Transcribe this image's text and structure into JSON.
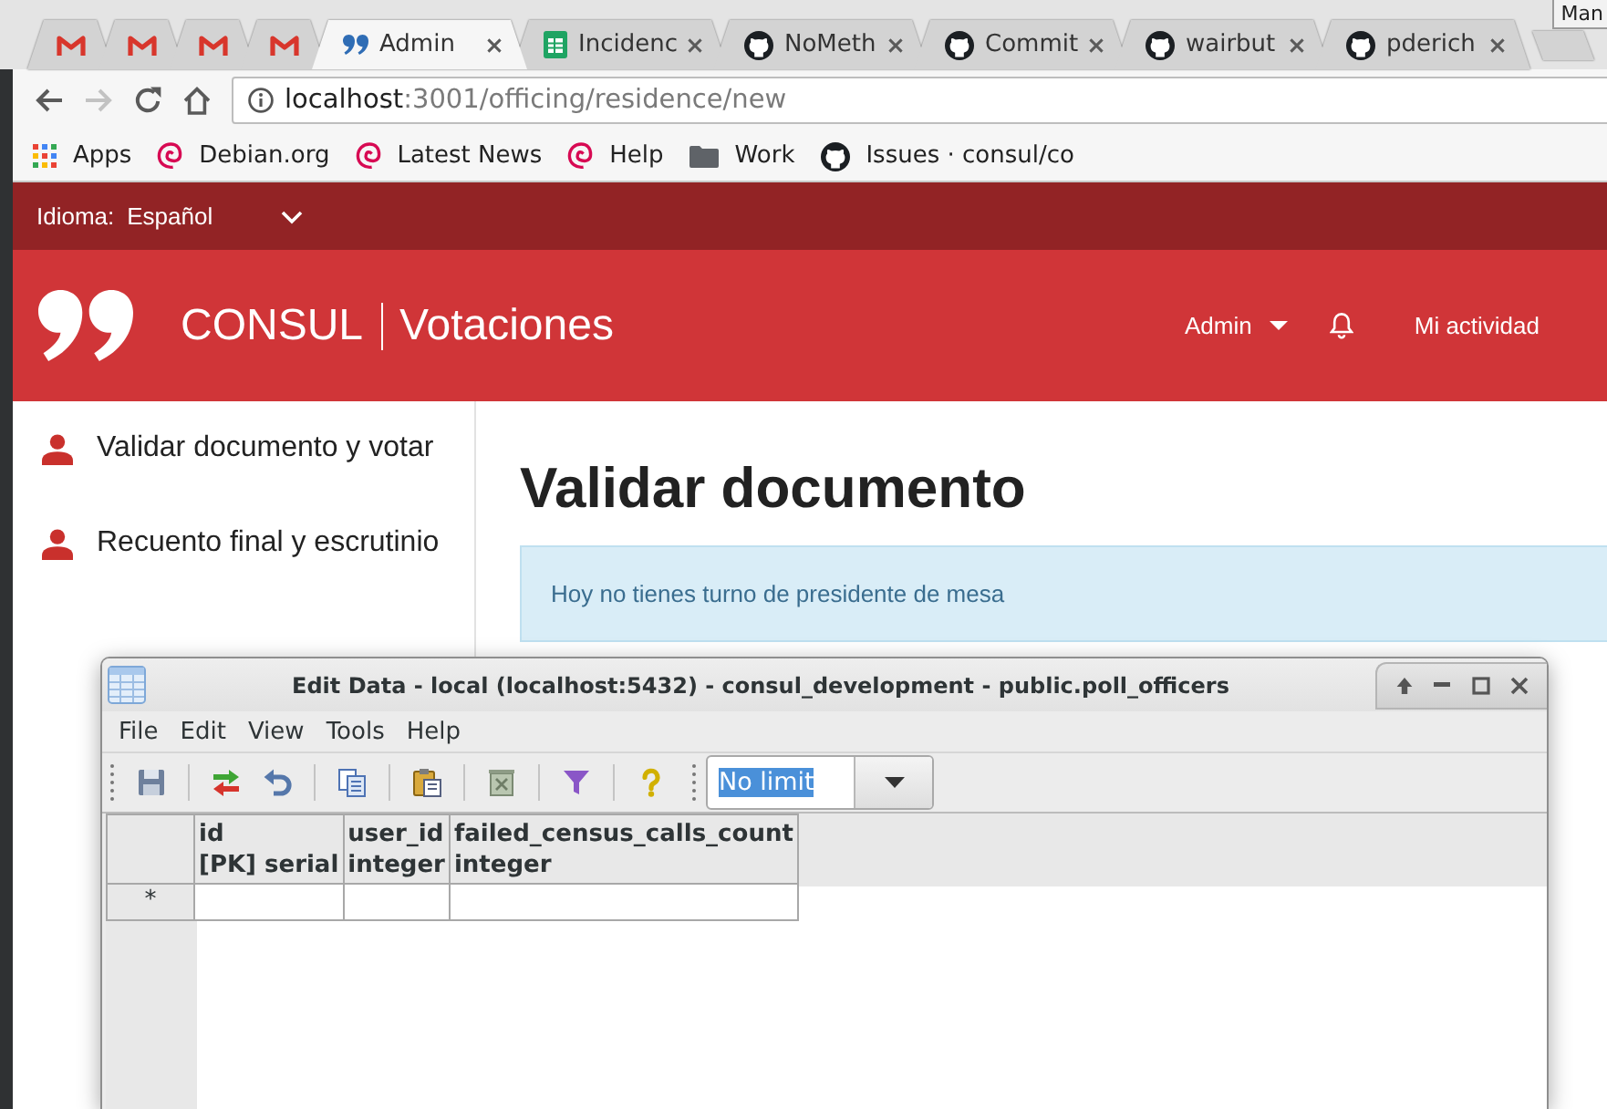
{
  "browser": {
    "tabs": [
      {
        "kind": "mail",
        "selected": false
      },
      {
        "kind": "mail",
        "selected": false
      },
      {
        "kind": "mail",
        "selected": false
      },
      {
        "kind": "mail",
        "selected": false
      },
      {
        "kind": "quotes",
        "title": "Admin",
        "selected": true
      },
      {
        "kind": "sheet",
        "title": "Incidenc",
        "selected": false
      },
      {
        "kind": "octocat",
        "title": "NoMeth",
        "selected": false
      },
      {
        "kind": "octocat",
        "title": "Commit",
        "selected": false
      },
      {
        "kind": "octocat",
        "title": "wairbut",
        "selected": false
      },
      {
        "kind": "octocat",
        "title": "pderich",
        "selected": false
      }
    ],
    "profile": "Man",
    "navigation": [
      {
        "kind": "back",
        "disabled": false
      },
      {
        "kind": "forward",
        "disabled": true
      },
      {
        "kind": "reload",
        "disabled": false
      },
      {
        "kind": "home",
        "disabled": false
      }
    ],
    "address": {
      "host": "localhost",
      "path": ":3001/officing/residence/new"
    },
    "bookmarks": [
      {
        "kind": "apps",
        "label": "Apps"
      },
      {
        "kind": "swirl",
        "label": "Debian.org"
      },
      {
        "kind": "swirl",
        "label": "Latest News"
      },
      {
        "kind": "swirl",
        "label": "Help"
      },
      {
        "kind": "folder",
        "label": "Work"
      },
      {
        "kind": "octocat",
        "label": "Issues · consul/co"
      }
    ]
  },
  "page": {
    "language": {
      "label": "Idioma:",
      "value": "Español"
    },
    "header": {
      "brand": "CONSUL",
      "section": "Votaciones",
      "user_menu": "Admin",
      "activity_link": "Mi actividad"
    },
    "sidebar": {
      "items": [
        {
          "label": "Validar documento y votar",
          "selected": false
        },
        {
          "label": "Recuento final y escrutinio",
          "selected": false
        }
      ]
    },
    "title": "Validar documento",
    "notice": "Hoy no tienes turno de presidente de mesa"
  },
  "dialog": {
    "title": "Edit Data - local (localhost:5432) - consul_development - public.poll_officers",
    "menu": [
      "File",
      "Edit",
      "View",
      "Tools",
      "Help"
    ],
    "row_limit": {
      "value": "No limit",
      "highlighted": true
    },
    "grid": {
      "columns": [
        {
          "name": "id",
          "type": "[PK] serial"
        },
        {
          "name": "user_id",
          "type": "integer"
        },
        {
          "name": "failed_census_calls_count",
          "type": "integer"
        }
      ],
      "rows": [
        {
          "marker": "*"
        }
      ]
    }
  }
}
